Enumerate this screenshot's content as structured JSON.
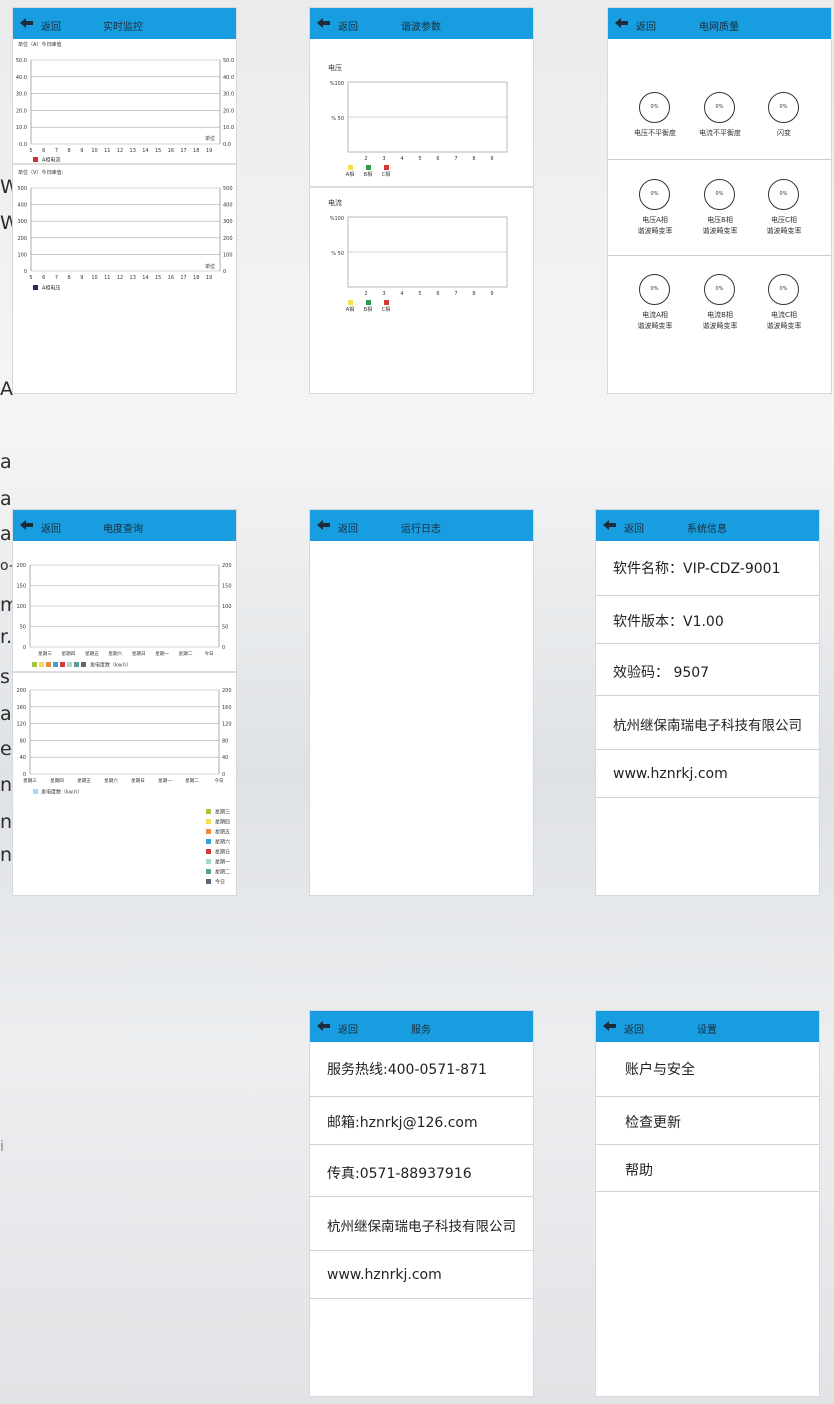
{
  "back_label": "返回",
  "background_text": [
    "W",
    "W",
    "A",
    "a",
    "a",
    "a",
    "o-",
    "m",
    "r.",
    "s",
    "a",
    "e",
    "n",
    "n",
    "n",
    "i"
  ],
  "realtime": {
    "title": "实时监控",
    "chart1": {
      "unit_label": "单位（A）今日峰值",
      "yticks": [
        "50.0",
        "40.0",
        "30.0",
        "20.0",
        "10.0",
        "0.0"
      ],
      "xticks": [
        "5",
        "6",
        "7",
        "8",
        "9",
        "10",
        "11",
        "12",
        "13",
        "14",
        "15",
        "16",
        "17",
        "18",
        "19"
      ],
      "unit_mark": "单位",
      "legend": "A相电流"
    },
    "chart2": {
      "unit_label": "单位（V）今日峰值：",
      "yticks": [
        "500",
        "400",
        "300",
        "200",
        "100",
        "0"
      ],
      "xticks": [
        "5",
        "6",
        "7",
        "8",
        "9",
        "10",
        "11",
        "12",
        "13",
        "14",
        "15",
        "16",
        "17",
        "18",
        "19"
      ],
      "unit_mark": "单位",
      "legend": "A相电压"
    }
  },
  "harmonic": {
    "title": "谐波参数",
    "voltage": {
      "label": "电压",
      "yticks": [
        "%100",
        "% 50"
      ],
      "xticks": [
        "2",
        "3",
        "4",
        "5",
        "6",
        "7",
        "8",
        "9"
      ],
      "legend": [
        "A相",
        "B相",
        "C相"
      ]
    },
    "current": {
      "label": "电流",
      "yticks": [
        "%100",
        "% 50"
      ],
      "xticks": [
        "2",
        "3",
        "4",
        "5",
        "6",
        "7",
        "8",
        "9"
      ],
      "legend": [
        "A相",
        "B相",
        "C相"
      ]
    },
    "legend_colors": [
      "#f2e04a",
      "#2e9a4e",
      "#d23a3a"
    ]
  },
  "power_quality": {
    "title": "电网质量",
    "items": [
      {
        "value": "0%",
        "label": [
          "电压不平衡度"
        ]
      },
      {
        "value": "0%",
        "label": [
          "电流不平衡度"
        ]
      },
      {
        "value": "0%",
        "label": [
          "闪变"
        ]
      },
      {
        "value": "0%",
        "label": [
          "电压A相",
          "谐波畸变率"
        ]
      },
      {
        "value": "0%",
        "label": [
          "电压B相",
          "谐波畸变率"
        ]
      },
      {
        "value": "0%",
        "label": [
          "电压C相",
          "谐波畸变率"
        ]
      },
      {
        "value": "0%",
        "label": [
          "电流A相",
          "谐波畸变率"
        ]
      },
      {
        "value": "0%",
        "label": [
          "电流B相",
          "谐波畸变率"
        ]
      },
      {
        "value": "0%",
        "label": [
          "电流C相",
          "谐波畸变率"
        ]
      }
    ]
  },
  "energy": {
    "title": "电度查询",
    "chart1": {
      "yticks": [
        "200",
        "150",
        "100",
        "50",
        "0"
      ],
      "xticks": [
        "星期三",
        "星期四",
        "星期五",
        "星期六",
        "星期日",
        "星期一",
        "星期二",
        "今日"
      ],
      "legend": "发电度数（kw.h）"
    },
    "chart2": {
      "yticks": [
        "200",
        "160",
        "120",
        "80",
        "40",
        "0"
      ],
      "xticks": [
        "星期三",
        "星期四",
        "星期五",
        "星期六",
        "星期日",
        "星期一",
        "星期二",
        "今日"
      ],
      "legend": "发电度数（kw.h）"
    },
    "legend_swatches": [
      "#a6c63a",
      "#f0e050",
      "#f08a3a",
      "#3aa0d8",
      "#d03a3a",
      "#a8d8c8",
      "#5aa08a",
      "#5a6a78"
    ],
    "day_legend": [
      "星期三",
      "星期四",
      "星期五",
      "星期六",
      "星期日",
      "星期一",
      "星期二",
      "今日"
    ]
  },
  "log": {
    "title": "运行日志"
  },
  "sysinfo": {
    "title": "系统信息",
    "rows": [
      "软件名称：VIP-CDZ-9001",
      "软件版本：V1.00",
      "效验码：  9507",
      "杭州继保南瑞电子科技有限公司",
      "www.hznrkj.com"
    ]
  },
  "service": {
    "title": "服务",
    "rows": [
      "服务热线:400-0571-871",
      "邮箱:hznrkj@126.com",
      "传真:0571-88937916",
      "杭州继保南瑞电子科技有限公司",
      "www.hznrkj.com"
    ]
  },
  "settings": {
    "title": "设置",
    "rows": [
      "账户与安全",
      "检查更新",
      "帮助"
    ]
  },
  "colors": {
    "header": "#189ee0",
    "line": "#cccccc"
  }
}
